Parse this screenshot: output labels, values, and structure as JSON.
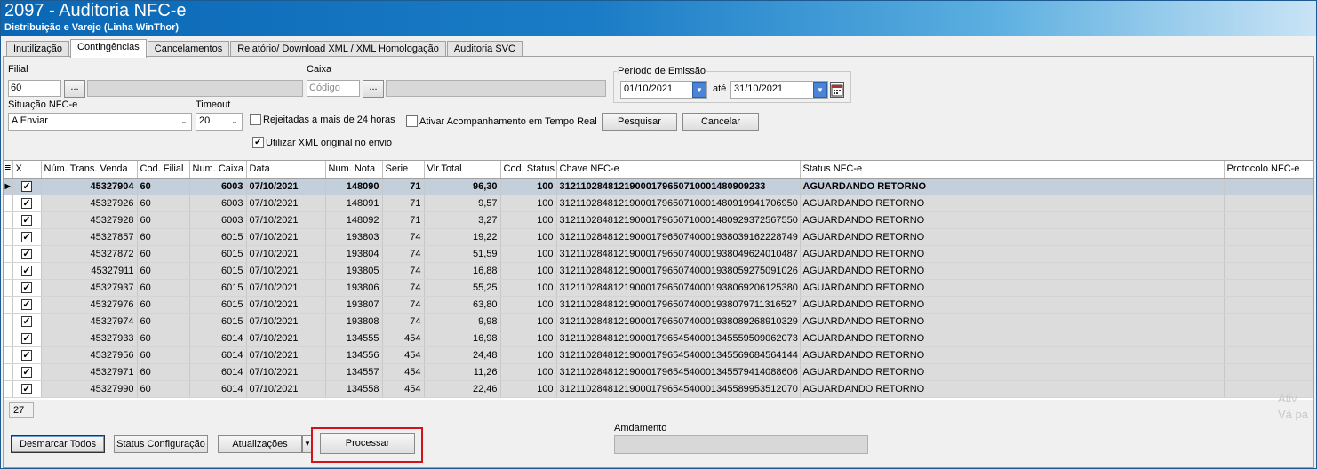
{
  "window": {
    "title": "2097 - Auditoria NFC-e",
    "subtitle": "Distribuição e Varejo (Linha WinThor)"
  },
  "tabs": [
    {
      "label": "Inutilização",
      "active": false
    },
    {
      "label": "Contingências",
      "active": true
    },
    {
      "label": "Cancelamentos",
      "active": false
    },
    {
      "label": "Relatório/ Download XML / XML Homologação",
      "active": false
    },
    {
      "label": "Auditoria SVC",
      "active": false
    }
  ],
  "filters": {
    "filial_label": "Filial",
    "filial_value": "60",
    "filial_lookup": "...",
    "caixa_label": "Caixa",
    "caixa_placeholder": "Código",
    "caixa_lookup": "...",
    "periodo_label": "Período de Emissão",
    "date_from": "01/10/2021",
    "ate_label": "até",
    "date_to": "31/10/2021",
    "situacao_label": "Situação NFC-e",
    "situacao_value": "A Enviar",
    "timeout_label": "Timeout",
    "timeout_value": "20",
    "rejeitadas_label": "Rejeitadas a mais de 24 horas",
    "rejeitadas_checked": false,
    "ativar_label": "Ativar Acompanhamento em Tempo Real",
    "ativar_checked": false,
    "utilizar_label": "Utilizar XML original no envio",
    "utilizar_checked": true,
    "pesquisar_label": "Pesquisar",
    "cancelar_label": "Cancelar"
  },
  "grid": {
    "columns": [
      "X",
      "Núm. Trans. Venda",
      "Cod. Filial",
      "Num. Caixa",
      "Data",
      "Num. Nota",
      "Serie",
      "Vlr.Total",
      "Cod. Status",
      "Chave NFC-e",
      "Status NFC-e",
      "Protocolo NFC-e"
    ],
    "rows": [
      {
        "checked": true,
        "trans": "45327904",
        "filial": "60",
        "caixa": "6003",
        "data": "07/10/2021",
        "nota": "148090",
        "serie": "71",
        "total": "96,30",
        "status_code": "100",
        "chave": "31211028481219000179650710001480909233",
        "status": "AGUARDANDO RETORNO",
        "protocolo": ""
      },
      {
        "checked": true,
        "trans": "45327926",
        "filial": "60",
        "caixa": "6003",
        "data": "07/10/2021",
        "nota": "148091",
        "serie": "71",
        "total": "9,57",
        "status_code": "100",
        "chave": "31211028481219000179650710001480919941706950",
        "status": "AGUARDANDO RETORNO",
        "protocolo": ""
      },
      {
        "checked": true,
        "trans": "45327928",
        "filial": "60",
        "caixa": "6003",
        "data": "07/10/2021",
        "nota": "148092",
        "serie": "71",
        "total": "3,27",
        "status_code": "100",
        "chave": "31211028481219000179650710001480929372567550",
        "status": "AGUARDANDO RETORNO",
        "protocolo": ""
      },
      {
        "checked": true,
        "trans": "45327857",
        "filial": "60",
        "caixa": "6015",
        "data": "07/10/2021",
        "nota": "193803",
        "serie": "74",
        "total": "19,22",
        "status_code": "100",
        "chave": "31211028481219000179650740001938039162228749",
        "status": "AGUARDANDO RETORNO",
        "protocolo": ""
      },
      {
        "checked": true,
        "trans": "45327872",
        "filial": "60",
        "caixa": "6015",
        "data": "07/10/2021",
        "nota": "193804",
        "serie": "74",
        "total": "51,59",
        "status_code": "100",
        "chave": "31211028481219000179650740001938049624010487",
        "status": "AGUARDANDO RETORNO",
        "protocolo": ""
      },
      {
        "checked": true,
        "trans": "45327911",
        "filial": "60",
        "caixa": "6015",
        "data": "07/10/2021",
        "nota": "193805",
        "serie": "74",
        "total": "16,88",
        "status_code": "100",
        "chave": "31211028481219000179650740001938059275091026",
        "status": "AGUARDANDO RETORNO",
        "protocolo": ""
      },
      {
        "checked": true,
        "trans": "45327937",
        "filial": "60",
        "caixa": "6015",
        "data": "07/10/2021",
        "nota": "193806",
        "serie": "74",
        "total": "55,25",
        "status_code": "100",
        "chave": "31211028481219000179650740001938069206125380",
        "status": "AGUARDANDO RETORNO",
        "protocolo": ""
      },
      {
        "checked": true,
        "trans": "45327976",
        "filial": "60",
        "caixa": "6015",
        "data": "07/10/2021",
        "nota": "193807",
        "serie": "74",
        "total": "63,80",
        "status_code": "100",
        "chave": "31211028481219000179650740001938079711316527",
        "status": "AGUARDANDO RETORNO",
        "protocolo": ""
      },
      {
        "checked": true,
        "trans": "45327974",
        "filial": "60",
        "caixa": "6015",
        "data": "07/10/2021",
        "nota": "193808",
        "serie": "74",
        "total": "9,98",
        "status_code": "100",
        "chave": "31211028481219000179650740001938089268910329",
        "status": "AGUARDANDO RETORNO",
        "protocolo": ""
      },
      {
        "checked": true,
        "trans": "45327933",
        "filial": "60",
        "caixa": "6014",
        "data": "07/10/2021",
        "nota": "134555",
        "serie": "454",
        "total": "16,98",
        "status_code": "100",
        "chave": "31211028481219000179654540001345559509062073",
        "status": "AGUARDANDO RETORNO",
        "protocolo": ""
      },
      {
        "checked": true,
        "trans": "45327956",
        "filial": "60",
        "caixa": "6014",
        "data": "07/10/2021",
        "nota": "134556",
        "serie": "454",
        "total": "24,48",
        "status_code": "100",
        "chave": "31211028481219000179654540001345569684564144",
        "status": "AGUARDANDO RETORNO",
        "protocolo": ""
      },
      {
        "checked": true,
        "trans": "45327971",
        "filial": "60",
        "caixa": "6014",
        "data": "07/10/2021",
        "nota": "134557",
        "serie": "454",
        "total": "11,26",
        "status_code": "100",
        "chave": "31211028481219000179654540001345579414088606",
        "status": "AGUARDANDO RETORNO",
        "protocolo": ""
      },
      {
        "checked": true,
        "trans": "45327990",
        "filial": "60",
        "caixa": "6014",
        "data": "07/10/2021",
        "nota": "134558",
        "serie": "454",
        "total": "22,46",
        "status_code": "100",
        "chave": "31211028481219000179654540001345589953512070",
        "status": "AGUARDANDO RETORNO",
        "protocolo": ""
      }
    ],
    "record_count": "27"
  },
  "watermark": {
    "line1": "Ativ",
    "line2": "Vá pa"
  },
  "bottom": {
    "desmarcar_label": "Desmarcar Todos",
    "status_config_label": "Status Configuração",
    "atualizacoes_label": "Atualizações",
    "processar_label": "Processar",
    "andamento_label": "Amdamento",
    "highlight_color": "#d4121c"
  }
}
